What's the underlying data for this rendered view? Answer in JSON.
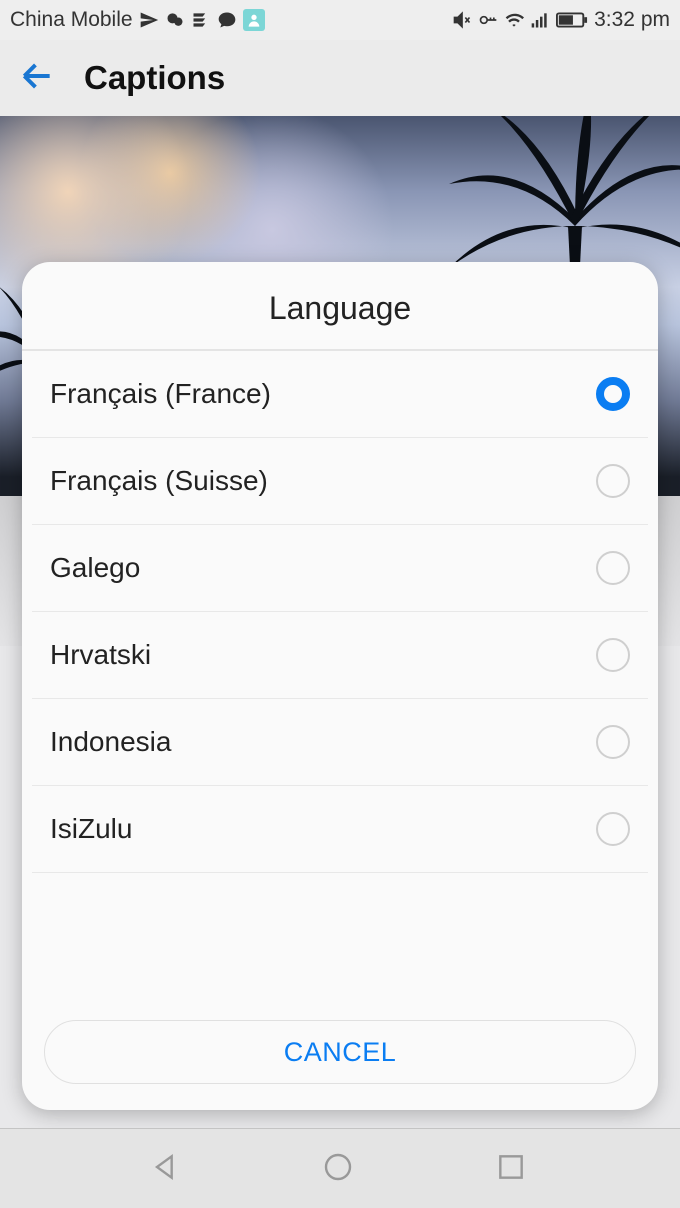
{
  "status": {
    "carrier": "China Mobile",
    "time": "3:32 pm"
  },
  "app": {
    "title": "Captions"
  },
  "dialog": {
    "title": "Language",
    "items": [
      {
        "label": "Français (France)",
        "selected": true
      },
      {
        "label": "Français (Suisse)",
        "selected": false
      },
      {
        "label": "Galego",
        "selected": false
      },
      {
        "label": "Hrvatski",
        "selected": false
      },
      {
        "label": "Indonesia",
        "selected": false
      },
      {
        "label": "IsiZulu",
        "selected": false
      }
    ],
    "cancel": "CANCEL"
  }
}
